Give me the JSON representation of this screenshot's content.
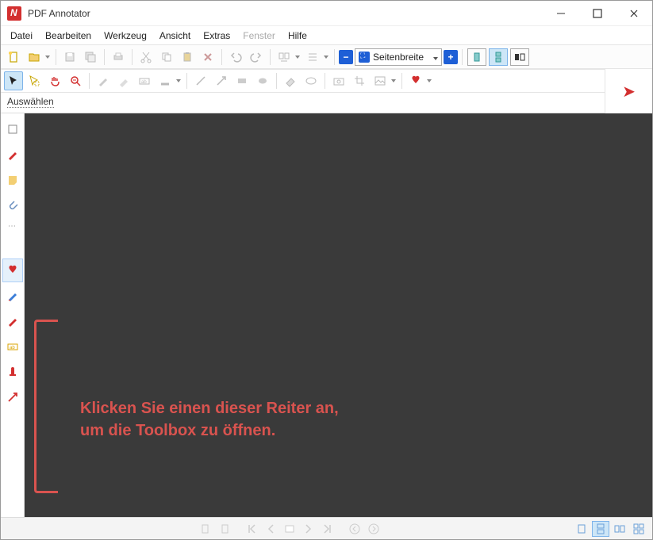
{
  "window": {
    "title": "PDF Annotator"
  },
  "menu": {
    "file": "Datei",
    "edit": "Bearbeiten",
    "tool": "Werkzeug",
    "view": "Ansicht",
    "extras": "Extras",
    "window": "Fenster",
    "help": "Hilfe"
  },
  "toolbar1": {
    "zoom_mode": "Seitenbreite"
  },
  "toolbar2": {
    "tooltip": "Auswählen"
  },
  "hint": {
    "line1": "Klicken Sie einen dieser Reiter an,",
    "line2": "um die Toolbox zu öffnen."
  }
}
